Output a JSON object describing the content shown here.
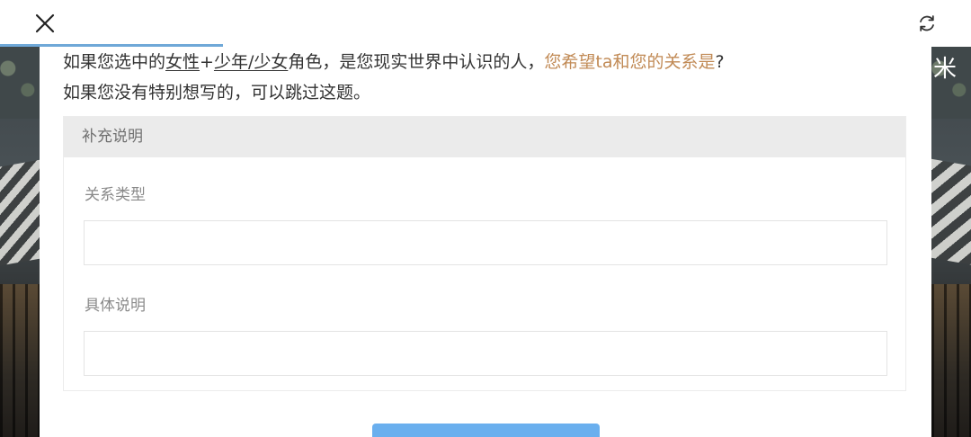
{
  "question": {
    "part1": "如果您选中的",
    "underline1": "女性",
    "plus": "+",
    "underline2": "少年/少女",
    "part2": "角色，是您现实世界中认识的人，",
    "highlight": "您希望ta和您的关系是",
    "part3": "?",
    "line2": "如果您没有特别想写的，可以跳过这题。"
  },
  "panel": {
    "title": "补充说明",
    "field1_label": "关系类型",
    "field1_value": "",
    "field2_label": "具体说明",
    "field2_value": ""
  },
  "progress": {
    "percent": 23,
    "color": "#6fa8d8"
  },
  "background": {
    "side_char": "米"
  },
  "colors": {
    "highlight": "#c18a55",
    "button": "#6aafee",
    "panel_header": "#ebebeb"
  },
  "icons": {
    "close": "close-icon",
    "refresh": "refresh-icon"
  }
}
